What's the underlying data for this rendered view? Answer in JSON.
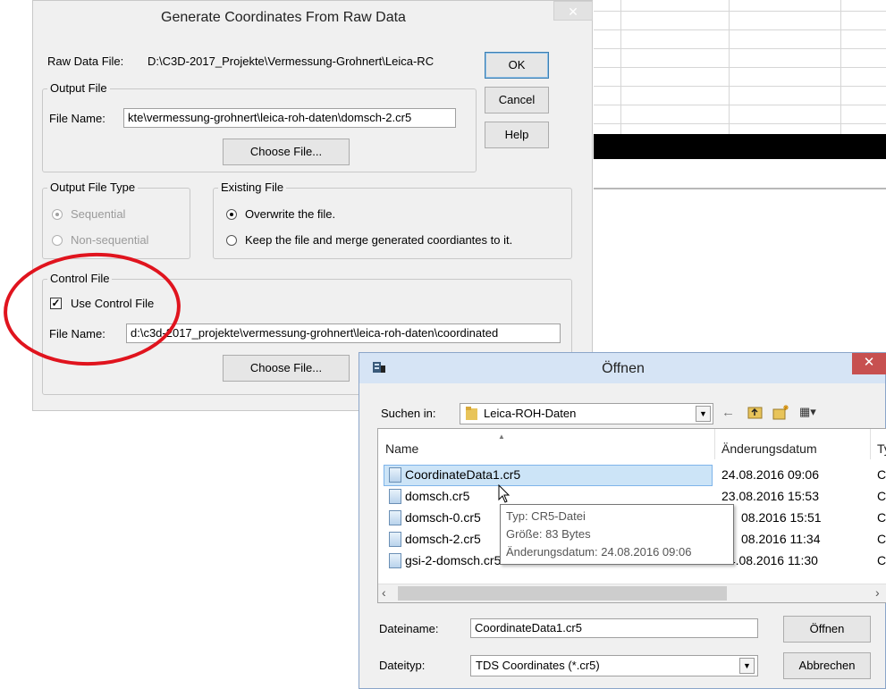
{
  "generate_dialog": {
    "title": "Generate Coordinates From Raw Data",
    "close_glyph": "✕",
    "raw_data_label": "Raw Data File:",
    "raw_data_value": "D:\\C3D-2017_Projekte\\Vermessung-Grohnert\\Leica-RC",
    "ok_label": "OK",
    "cancel_label": "Cancel",
    "help_label": "Help",
    "output_file": {
      "group_title": "Output File",
      "file_name_label": "File Name:",
      "file_name_value": "kte\\vermessung-grohnert\\leica-roh-daten\\domsch-2.cr5",
      "choose_label": "Choose File..."
    },
    "output_file_type": {
      "group_title": "Output File Type",
      "sequential_label": "Sequential",
      "non_sequential_label": "Non-sequential"
    },
    "existing_file": {
      "group_title": "Existing File",
      "overwrite_label": "Overwrite the file.",
      "merge_label": "Keep the file and merge generated coordiantes to it."
    },
    "control_file": {
      "group_title": "Control File",
      "use_label": "Use Control File",
      "check_glyph": "✓",
      "file_name_label": "File Name:",
      "file_name_value": "d:\\c3d-2017_projekte\\vermessung-grohnert\\leica-roh-daten\\coordinated",
      "choose_label": "Choose File..."
    }
  },
  "open_dialog": {
    "title": "Öffnen",
    "close_glyph": "✕",
    "look_in_label": "Suchen in:",
    "look_in_value": "Leica-ROH-Daten",
    "toolbar_glyphs": {
      "back": "←",
      "up": "🗀",
      "new_folder": "✱",
      "view": "▦▾"
    },
    "columns": {
      "name": "Name",
      "modified": "Änderungsdatum",
      "type": "Ty"
    },
    "files": [
      {
        "name": "CoordinateData1.cr5",
        "modified": "24.08.2016 09:06",
        "type": "Cl"
      },
      {
        "name": "domsch.cr5",
        "modified": "23.08.2016 15:53",
        "type": "Cl"
      },
      {
        "name": "domsch-0.cr5",
        "modified": "08.2016 15:51",
        "type": "Cl"
      },
      {
        "name": "domsch-2.cr5",
        "modified": "08.2016 11:34",
        "type": "Cl"
      },
      {
        "name": "gsi-2-domsch.cr5",
        "modified": "24.08.2016 11:30",
        "type": "Cl"
      }
    ],
    "tooltip": {
      "type_line": "Typ: CR5-Datei",
      "size_line": "Größe: 83 Bytes",
      "date_line": "Änderungsdatum: 24.08.2016 09:06"
    },
    "filename_label": "Dateiname:",
    "filename_value": "CoordinateData1.cr5",
    "filetype_label": "Dateityp:",
    "filetype_value": "TDS Coordinates (*.cr5)",
    "open_label": "Öffnen",
    "cancel_label": "Abbrechen",
    "scroll_left_glyph": "‹",
    "scroll_right_glyph": "›"
  },
  "colors": {
    "annotation": "#e0141e",
    "selection": "#cce4f7",
    "close_red": "#c75050"
  }
}
